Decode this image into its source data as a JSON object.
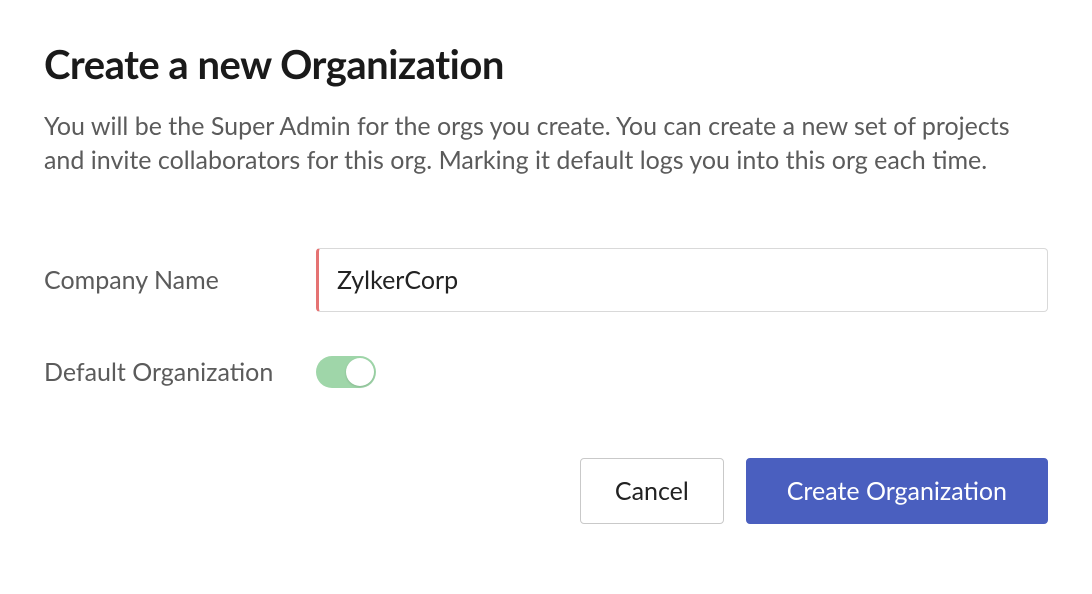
{
  "dialog": {
    "title": "Create a new Organization",
    "description": "You will be the Super Admin for the orgs you create. You can create a new set of projects and invite collaborators for this org. Marking it default logs you into this org each time."
  },
  "form": {
    "company_name": {
      "label": "Company Name",
      "value": "ZylkerCorp"
    },
    "default_org": {
      "label": "Default Organization",
      "enabled": true
    }
  },
  "buttons": {
    "cancel": "Cancel",
    "create": "Create Organization"
  }
}
